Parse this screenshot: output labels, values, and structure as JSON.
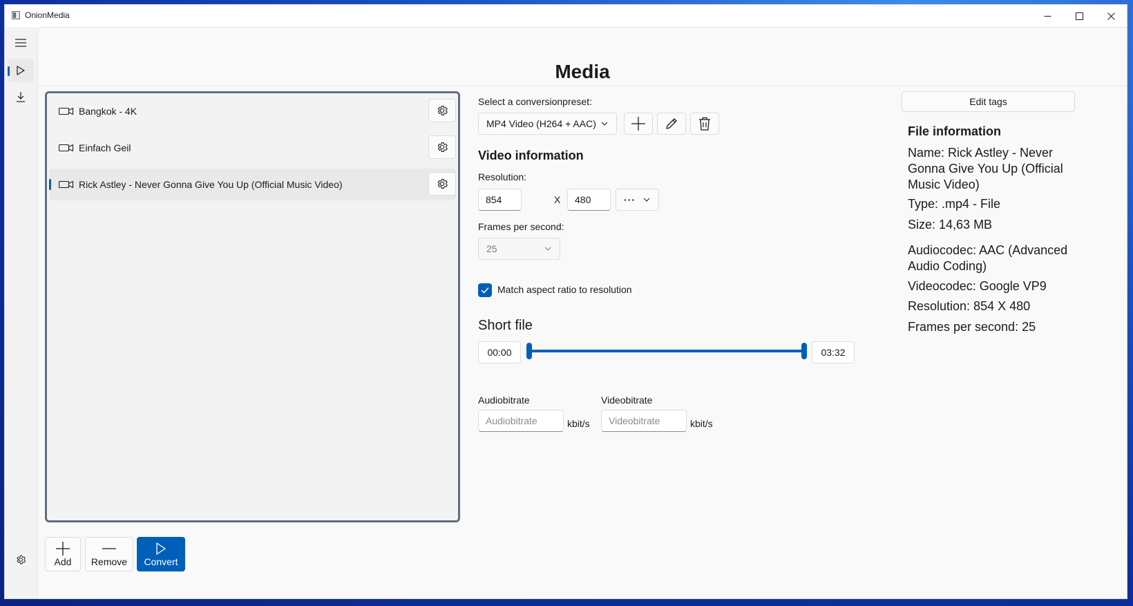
{
  "window": {
    "title": "OnionMedia"
  },
  "page": {
    "title": "Media"
  },
  "media_items": [
    {
      "label": "Bangkok - 4K",
      "selected": false
    },
    {
      "label": "Einfach Geil",
      "selected": false
    },
    {
      "label": "Rick Astley - Never Gonna Give You Up (Official Music Video)",
      "selected": true
    }
  ],
  "bottom_bar": {
    "add_label": "Add",
    "remove_label": "Remove",
    "convert_label": "Convert"
  },
  "preset": {
    "label": "Select a conversionpreset:",
    "selected": "MP4 Video (H264 + AAC)"
  },
  "video_info": {
    "heading": "Video information",
    "resolution_label": "Resolution:",
    "width": "854",
    "separator": "X",
    "height": "480",
    "more_label": "···",
    "fps_label": "Frames per second:",
    "fps_value": "25",
    "match_aspect_label": "Match aspect ratio to resolution",
    "match_aspect_checked": true
  },
  "short_file": {
    "heading": "Short file",
    "start": "00:00",
    "end": "03:32",
    "range_start_fraction": 0.0,
    "range_end_fraction": 1.0
  },
  "bitrate": {
    "audio_label": "Audiobitrate",
    "audio_placeholder": "Audiobitrate",
    "video_label": "Videobitrate",
    "video_placeholder": "Videobitrate",
    "unit": "kbit/s"
  },
  "file_info": {
    "edit_tags_label": "Edit tags",
    "heading": "File information",
    "name": "Name: Rick Astley - Never Gonna Give You Up (Official Music Video)",
    "type": "Type: .mp4 - File",
    "size": "Size: 14,63 MB",
    "audiocodec": "Audiocodec: AAC (Advanced Audio Coding)",
    "videocodec": "Videocodec: Google VP9",
    "resolution": "Resolution: 854 X 480",
    "fps": "Frames per second: 25"
  },
  "colors": {
    "accent": "#005fb8",
    "list_border": "#5f6f7e",
    "background": "#f9f9f9"
  }
}
